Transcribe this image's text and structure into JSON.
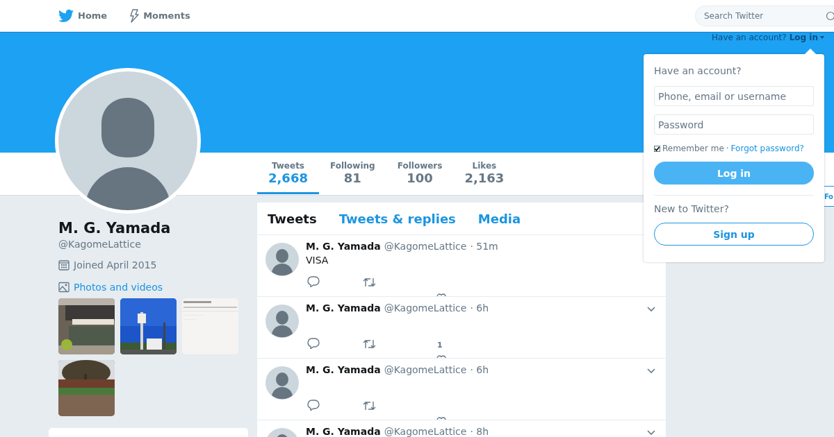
{
  "nav": {
    "items": [
      {
        "label": "Home"
      },
      {
        "label": "Moments"
      }
    ],
    "search": {
      "placeholder": "Search Twitter"
    }
  },
  "banner": {
    "login_prompt": "Have an account?",
    "login_link": "Log in"
  },
  "stats": [
    {
      "label": "Tweets",
      "value": "2,668",
      "selected": true
    },
    {
      "label": "Following",
      "value": "81",
      "selected": false
    },
    {
      "label": "Followers",
      "value": "100",
      "selected": false
    },
    {
      "label": "Likes",
      "value": "2,163",
      "selected": false
    }
  ],
  "follow_button": {
    "label": "Fo"
  },
  "profile": {
    "name": "M. G. Yamada",
    "handle": "@KagomeLattice",
    "joined": "Joined April 2015",
    "media_link": "Photos and videos"
  },
  "timeline": {
    "tabs": [
      {
        "label": "Tweets",
        "selected": true
      },
      {
        "label": "Tweets & replies",
        "selected": false
      },
      {
        "label": "Media",
        "selected": false
      }
    ],
    "tweets": [
      {
        "name": "M. G. Yamada",
        "handle": "@KagomeLattice",
        "time": "· 51m",
        "text": "VISA",
        "has_menu": false
      },
      {
        "name": "M. G. Yamada",
        "handle": "@KagomeLattice",
        "time": "· 6h",
        "like_count": "1",
        "has_menu": true
      },
      {
        "name": "M. G. Yamada",
        "handle": "@KagomeLattice",
        "time": "· 6h",
        "has_menu": true
      },
      {
        "name": "M. G. Yamada",
        "handle": "@KagomeLattice",
        "time": "· 8h",
        "has_menu": true
      }
    ]
  },
  "login_popup": {
    "title": "Have an account?",
    "username": {
      "placeholder": "Phone, email or username"
    },
    "password": {
      "placeholder": "Password"
    },
    "remember": {
      "label": "Remember me",
      "checked": true
    },
    "separator": "·",
    "forgot_link": "Forgot password?",
    "login_button": "Log in",
    "signup_prompt": "New to Twitter?",
    "signup_button": "Sign up"
  }
}
